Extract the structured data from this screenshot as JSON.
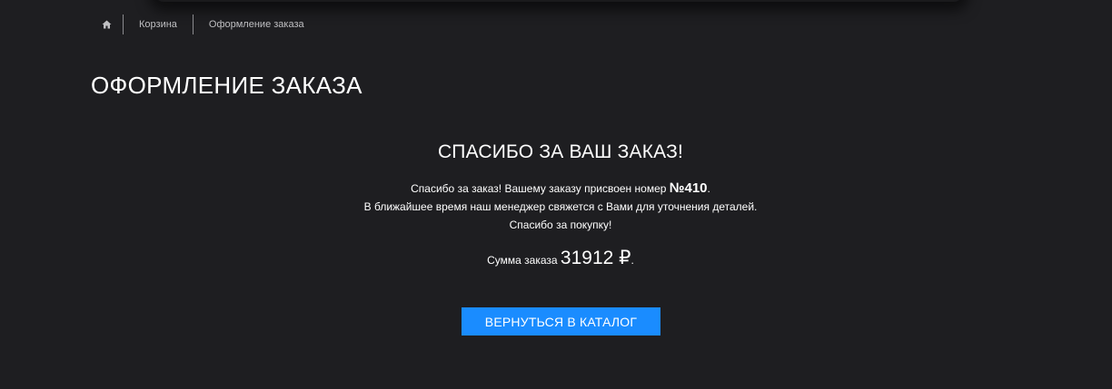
{
  "breadcrumb": {
    "home_icon": "home-icon",
    "items": [
      {
        "label": "Корзина"
      },
      {
        "label": "Оформление заказа"
      }
    ]
  },
  "page_title": "ОФОРМЛЕНИЕ ЗАКАЗА",
  "confirmation": {
    "heading": "СПАСИБО ЗА ВАШ ЗАКАЗ!",
    "line1_prefix": "Спасибо за заказ! Вашему заказу присвоен номер ",
    "order_number": "№410",
    "line1_suffix": ".",
    "line2": "В ближайшее время наш менеджер свяжется с Вами для уточнения деталей.",
    "line3": "Спасибо за покупку!",
    "sum_label": "Сумма заказа ",
    "sum_value": "31912 ₽",
    "sum_suffix": "."
  },
  "catalog_button": {
    "label": "ВЕРНУТЬСЯ В КАТАЛОГ"
  },
  "colors": {
    "background": "#1e1e21",
    "accent": "#1a8cff",
    "text": "#ffffff",
    "muted": "#bfbfc2"
  }
}
